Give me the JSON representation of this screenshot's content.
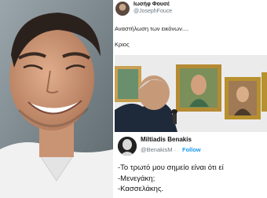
{
  "tweet": {
    "name": "Ιωσήφ Φουσέ",
    "handle": "@JosephFouce",
    "text": "Αναστήλωση των εικόνων....",
    "caption": "Κριος"
  },
  "quote_card": {
    "name": "Miltiadis Benakis",
    "handle": "@BenakisM",
    "separator": "·",
    "follow_label": "Follow",
    "lines": [
      "-Το τρωτό μου σημείο είναι ότι εί",
      "-Μενεγάκη;",
      "-Κασσελάκης."
    ]
  }
}
